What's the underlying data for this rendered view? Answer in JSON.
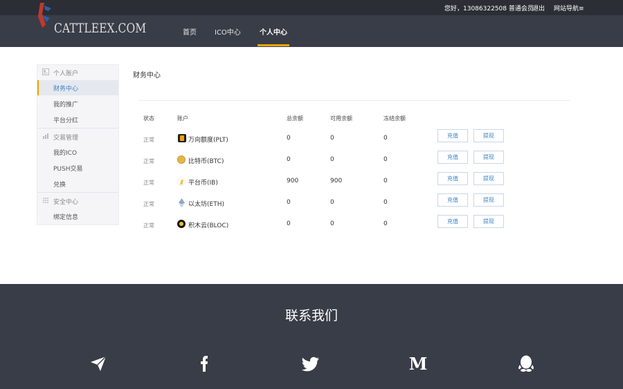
{
  "topbar": {
    "greeting": "您好，13086322508 普通会员",
    "logout": "退出",
    "site_nav": "网站导航≡"
  },
  "header": {
    "logo_text": "CATTLEEX.COM",
    "nav": [
      "首页",
      "ICO中心",
      "个人中心"
    ],
    "active_nav": "个人中心",
    "accent_color": "#f0a400"
  },
  "sidebar": {
    "groups": [
      {
        "title": "个人账户",
        "icon": "user-icon",
        "items": [
          "财务中心",
          "我的推广",
          "平台分红"
        ]
      },
      {
        "title": "交易管理",
        "icon": "chart-icon",
        "items": [
          "我的ICO",
          "PUSH交易",
          "兑换"
        ]
      },
      {
        "title": "安全中心",
        "icon": "grid-icon",
        "items": [
          "绑定信息"
        ]
      }
    ],
    "active_item": "财务中心"
  },
  "page": {
    "title": "财务中心"
  },
  "table": {
    "headers": [
      "状态",
      "账户",
      "总余额",
      "可用余额",
      "冻结余额"
    ],
    "rows": [
      {
        "status": "正常",
        "account": "万向额度(PLT)",
        "total": "0",
        "available": "0",
        "frozen": "0",
        "icon": "plt-coin-icon",
        "color": "#1f1f2b"
      },
      {
        "status": "正常",
        "account": "比特币(BTC)",
        "total": "0",
        "available": "0",
        "frozen": "0",
        "icon": "btc-coin-icon",
        "color": "#e0b84a"
      },
      {
        "status": "正常",
        "account": "平台币(IB)",
        "total": "900",
        "available": "900",
        "frozen": "0",
        "icon": "ib-coin-icon",
        "color": "#f3c21b"
      },
      {
        "status": "正常",
        "account": "以太坊(ETH)",
        "total": "0",
        "available": "0",
        "frozen": "0",
        "icon": "eth-coin-icon",
        "color": "#8fa8c8"
      },
      {
        "status": "正常",
        "account": "积木云(BLOC)",
        "total": "0",
        "available": "0",
        "frozen": "0",
        "icon": "bloc-coin-icon",
        "color": "#111111"
      }
    ],
    "recharge_label": "充值",
    "withdraw_label": "提现"
  },
  "footer": {
    "title": "联系我们",
    "icons": [
      "telegram-icon",
      "facebook-icon",
      "twitter-icon",
      "medium-icon",
      "qq-icon"
    ]
  }
}
